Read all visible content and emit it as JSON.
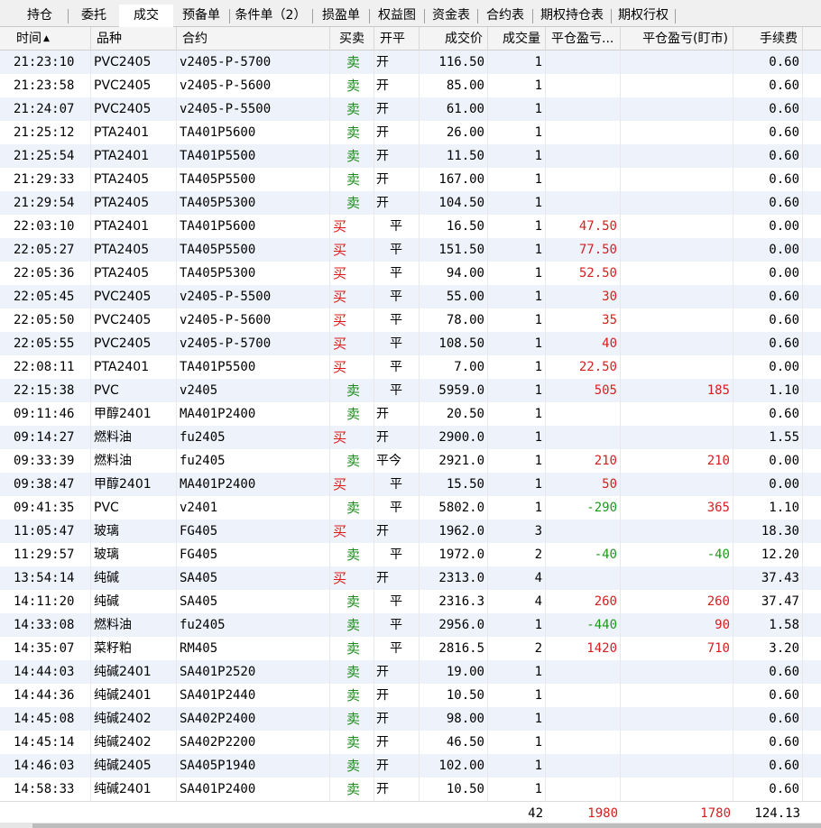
{
  "tabs": [
    {
      "label": "持仓",
      "active": false
    },
    {
      "label": "委托",
      "active": false
    },
    {
      "label": "成交",
      "active": true
    },
    {
      "label": "预备单",
      "active": false
    },
    {
      "label": "条件单（2）",
      "active": false
    },
    {
      "label": "损盈单",
      "active": false
    },
    {
      "label": "权益图",
      "active": false
    },
    {
      "label": "资金表",
      "active": false
    },
    {
      "label": "合约表",
      "active": false
    },
    {
      "label": "期权持仓表",
      "active": false
    },
    {
      "label": "期权行权",
      "active": false
    }
  ],
  "columns": [
    {
      "key": "time",
      "label": "时间",
      "sort_icon": "▲"
    },
    {
      "key": "variety",
      "label": "品种"
    },
    {
      "key": "contract",
      "label": "合约"
    },
    {
      "key": "side",
      "label": "买卖"
    },
    {
      "key": "oc",
      "label": "开平"
    },
    {
      "key": "price",
      "label": "成交价"
    },
    {
      "key": "qty",
      "label": "成交量"
    },
    {
      "key": "close_pnl",
      "label": "平仓盈亏..."
    },
    {
      "key": "close_pnl_mtm",
      "label": "平仓盈亏(盯市)"
    },
    {
      "key": "fee",
      "label": "手续费"
    }
  ],
  "rows": [
    {
      "time": "21:23:10",
      "variety": "PVC2405",
      "contract": "v2405-P-5700",
      "side": "卖",
      "oc": "开",
      "price": "116.50",
      "qty": "1",
      "close_pnl": "",
      "close_pnl_mtm": "",
      "fee": "0.60"
    },
    {
      "time": "21:23:58",
      "variety": "PVC2405",
      "contract": "v2405-P-5600",
      "side": "卖",
      "oc": "开",
      "price": "85.00",
      "qty": "1",
      "close_pnl": "",
      "close_pnl_mtm": "",
      "fee": "0.60"
    },
    {
      "time": "21:24:07",
      "variety": "PVC2405",
      "contract": "v2405-P-5500",
      "side": "卖",
      "oc": "开",
      "price": "61.00",
      "qty": "1",
      "close_pnl": "",
      "close_pnl_mtm": "",
      "fee": "0.60"
    },
    {
      "time": "21:25:12",
      "variety": "PTA2401",
      "contract": "TA401P5600",
      "side": "卖",
      "oc": "开",
      "price": "26.00",
      "qty": "1",
      "close_pnl": "",
      "close_pnl_mtm": "",
      "fee": "0.60"
    },
    {
      "time": "21:25:54",
      "variety": "PTA2401",
      "contract": "TA401P5500",
      "side": "卖",
      "oc": "开",
      "price": "11.50",
      "qty": "1",
      "close_pnl": "",
      "close_pnl_mtm": "",
      "fee": "0.60"
    },
    {
      "time": "21:29:33",
      "variety": "PTA2405",
      "contract": "TA405P5500",
      "side": "卖",
      "oc": "开",
      "price": "167.00",
      "qty": "1",
      "close_pnl": "",
      "close_pnl_mtm": "",
      "fee": "0.60"
    },
    {
      "time": "21:29:54",
      "variety": "PTA2405",
      "contract": "TA405P5300",
      "side": "卖",
      "oc": "开",
      "price": "104.50",
      "qty": "1",
      "close_pnl": "",
      "close_pnl_mtm": "",
      "fee": "0.60"
    },
    {
      "time": "22:03:10",
      "variety": "PTA2401",
      "contract": "TA401P5600",
      "side": "买",
      "oc": "平",
      "price": "16.50",
      "qty": "1",
      "close_pnl": "47.50",
      "close_pnl_mtm": "",
      "fee": "0.00"
    },
    {
      "time": "22:05:27",
      "variety": "PTA2405",
      "contract": "TA405P5500",
      "side": "买",
      "oc": "平",
      "price": "151.50",
      "qty": "1",
      "close_pnl": "77.50",
      "close_pnl_mtm": "",
      "fee": "0.00"
    },
    {
      "time": "22:05:36",
      "variety": "PTA2405",
      "contract": "TA405P5300",
      "side": "买",
      "oc": "平",
      "price": "94.00",
      "qty": "1",
      "close_pnl": "52.50",
      "close_pnl_mtm": "",
      "fee": "0.00"
    },
    {
      "time": "22:05:45",
      "variety": "PVC2405",
      "contract": "v2405-P-5500",
      "side": "买",
      "oc": "平",
      "price": "55.00",
      "qty": "1",
      "close_pnl": "30",
      "close_pnl_mtm": "",
      "fee": "0.60"
    },
    {
      "time": "22:05:50",
      "variety": "PVC2405",
      "contract": "v2405-P-5600",
      "side": "买",
      "oc": "平",
      "price": "78.00",
      "qty": "1",
      "close_pnl": "35",
      "close_pnl_mtm": "",
      "fee": "0.60"
    },
    {
      "time": "22:05:55",
      "variety": "PVC2405",
      "contract": "v2405-P-5700",
      "side": "买",
      "oc": "平",
      "price": "108.50",
      "qty": "1",
      "close_pnl": "40",
      "close_pnl_mtm": "",
      "fee": "0.60"
    },
    {
      "time": "22:08:11",
      "variety": "PTA2401",
      "contract": "TA401P5500",
      "side": "买",
      "oc": "平",
      "price": "7.00",
      "qty": "1",
      "close_pnl": "22.50",
      "close_pnl_mtm": "",
      "fee": "0.00"
    },
    {
      "time": "22:15:38",
      "variety": "PVC",
      "contract": "v2405",
      "side": "卖",
      "oc": "平",
      "price": "5959.0",
      "qty": "1",
      "close_pnl": "505",
      "close_pnl_mtm": "185",
      "fee": "1.10"
    },
    {
      "time": "09:11:46",
      "variety": "甲醇2401",
      "contract": "MA401P2400",
      "side": "卖",
      "oc": "开",
      "price": "20.50",
      "qty": "1",
      "close_pnl": "",
      "close_pnl_mtm": "",
      "fee": "0.60"
    },
    {
      "time": "09:14:27",
      "variety": "燃料油",
      "contract": "fu2405",
      "side": "买",
      "oc": "开",
      "price": "2900.0",
      "qty": "1",
      "close_pnl": "",
      "close_pnl_mtm": "",
      "fee": "1.55"
    },
    {
      "time": "09:33:39",
      "variety": "燃料油",
      "contract": "fu2405",
      "side": "卖",
      "oc": "平今",
      "price": "2921.0",
      "qty": "1",
      "close_pnl": "210",
      "close_pnl_mtm": "210",
      "fee": "0.00"
    },
    {
      "time": "09:38:47",
      "variety": "甲醇2401",
      "contract": "MA401P2400",
      "side": "买",
      "oc": "平",
      "price": "15.50",
      "qty": "1",
      "close_pnl": "50",
      "close_pnl_mtm": "",
      "fee": "0.00"
    },
    {
      "time": "09:41:35",
      "variety": "PVC",
      "contract": "v2401",
      "side": "卖",
      "oc": "平",
      "price": "5802.0",
      "qty": "1",
      "close_pnl": "-290",
      "close_pnl_mtm": "365",
      "fee": "1.10"
    },
    {
      "time": "11:05:47",
      "variety": "玻璃",
      "contract": "FG405",
      "side": "买",
      "oc": "开",
      "price": "1962.0",
      "qty": "3",
      "close_pnl": "",
      "close_pnl_mtm": "",
      "fee": "18.30"
    },
    {
      "time": "11:29:57",
      "variety": "玻璃",
      "contract": "FG405",
      "side": "卖",
      "oc": "平",
      "price": "1972.0",
      "qty": "2",
      "close_pnl": "-40",
      "close_pnl_mtm": "-40",
      "fee": "12.20"
    },
    {
      "time": "13:54:14",
      "variety": "纯碱",
      "contract": "SA405",
      "side": "买",
      "oc": "开",
      "price": "2313.0",
      "qty": "4",
      "close_pnl": "",
      "close_pnl_mtm": "",
      "fee": "37.43"
    },
    {
      "time": "14:11:20",
      "variety": "纯碱",
      "contract": "SA405",
      "side": "卖",
      "oc": "平",
      "price": "2316.3",
      "qty": "4",
      "close_pnl": "260",
      "close_pnl_mtm": "260",
      "fee": "37.47"
    },
    {
      "time": "14:33:08",
      "variety": "燃料油",
      "contract": "fu2405",
      "side": "卖",
      "oc": "平",
      "price": "2956.0",
      "qty": "1",
      "close_pnl": "-440",
      "close_pnl_mtm": "90",
      "fee": "1.58"
    },
    {
      "time": "14:35:07",
      "variety": "菜籽粕",
      "contract": "RM405",
      "side": "卖",
      "oc": "平",
      "price": "2816.5",
      "qty": "2",
      "close_pnl": "1420",
      "close_pnl_mtm": "710",
      "fee": "3.20"
    },
    {
      "time": "14:44:03",
      "variety": "纯碱2401",
      "contract": "SA401P2520",
      "side": "卖",
      "oc": "开",
      "price": "19.00",
      "qty": "1",
      "close_pnl": "",
      "close_pnl_mtm": "",
      "fee": "0.60"
    },
    {
      "time": "14:44:36",
      "variety": "纯碱2401",
      "contract": "SA401P2440",
      "side": "卖",
      "oc": "开",
      "price": "10.50",
      "qty": "1",
      "close_pnl": "",
      "close_pnl_mtm": "",
      "fee": "0.60"
    },
    {
      "time": "14:45:08",
      "variety": "纯碱2402",
      "contract": "SA402P2400",
      "side": "卖",
      "oc": "开",
      "price": "98.00",
      "qty": "1",
      "close_pnl": "",
      "close_pnl_mtm": "",
      "fee": "0.60"
    },
    {
      "time": "14:45:14",
      "variety": "纯碱2402",
      "contract": "SA402P2200",
      "side": "卖",
      "oc": "开",
      "price": "46.50",
      "qty": "1",
      "close_pnl": "",
      "close_pnl_mtm": "",
      "fee": "0.60"
    },
    {
      "time": "14:46:03",
      "variety": "纯碱2405",
      "contract": "SA405P1940",
      "side": "卖",
      "oc": "开",
      "price": "102.00",
      "qty": "1",
      "close_pnl": "",
      "close_pnl_mtm": "",
      "fee": "0.60"
    },
    {
      "time": "14:58:33",
      "variety": "纯碱2401",
      "contract": "SA401P2400",
      "side": "卖",
      "oc": "开",
      "price": "10.50",
      "qty": "1",
      "close_pnl": "",
      "close_pnl_mtm": "",
      "fee": "0.60"
    }
  ],
  "totals": {
    "qty": "42",
    "close_pnl": "1980",
    "close_pnl_mtm": "1780",
    "fee": "124.13"
  },
  "colors": {
    "buy": "#e01818",
    "sell": "#1c8c1c",
    "profit": "#d42020",
    "loss": "#1c9a1c",
    "odd_row": "#eef2fa"
  }
}
